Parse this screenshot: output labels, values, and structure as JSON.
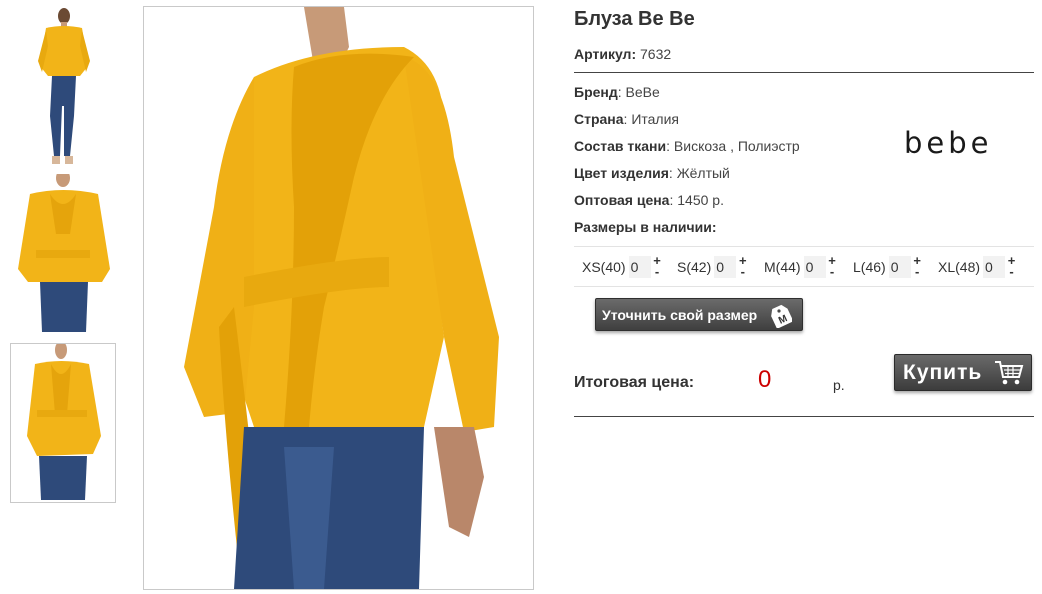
{
  "product": {
    "title": "Блуза Be Be",
    "sku_label": "Артикул:",
    "sku_value": "7632",
    "brand_label": "Бренд",
    "brand_value": "BeBe",
    "country_label": "Страна",
    "country_value": "Италия",
    "fabric_label": "Состав ткани",
    "fabric_value": "Вискоза , Полиэстр",
    "color_label": "Цвет изделия",
    "color_value": "Жёлтый",
    "price_label": "Оптовая цена",
    "price_value": "1450 р.",
    "sizes_label": "Размеры в наличии:",
    "brand_logo": "bebe"
  },
  "sizes": [
    {
      "label": "XS(40)",
      "qty": "0"
    },
    {
      "label": "S(42)",
      "qty": "0"
    },
    {
      "label": "M(44)",
      "qty": "0"
    },
    {
      "label": "L(46)",
      "qty": "0"
    },
    {
      "label": "XL(48)",
      "qty": "0"
    }
  ],
  "stepper": {
    "plus": "+",
    "minus": "-"
  },
  "size_button": {
    "label": "Уточнить свой размер",
    "tag_letter": "M"
  },
  "total": {
    "label": "Итоговая цена:",
    "value": "0",
    "currency": "р."
  },
  "buy_button": {
    "label": "Купить"
  },
  "icons": {
    "size_tag": "size-tag-icon",
    "cart": "shopping-cart-icon"
  },
  "colors": {
    "blouse": "#f2b418",
    "jeans": "#2e4a7a",
    "price": "#cc0000",
    "button": "#4a4a4a"
  }
}
